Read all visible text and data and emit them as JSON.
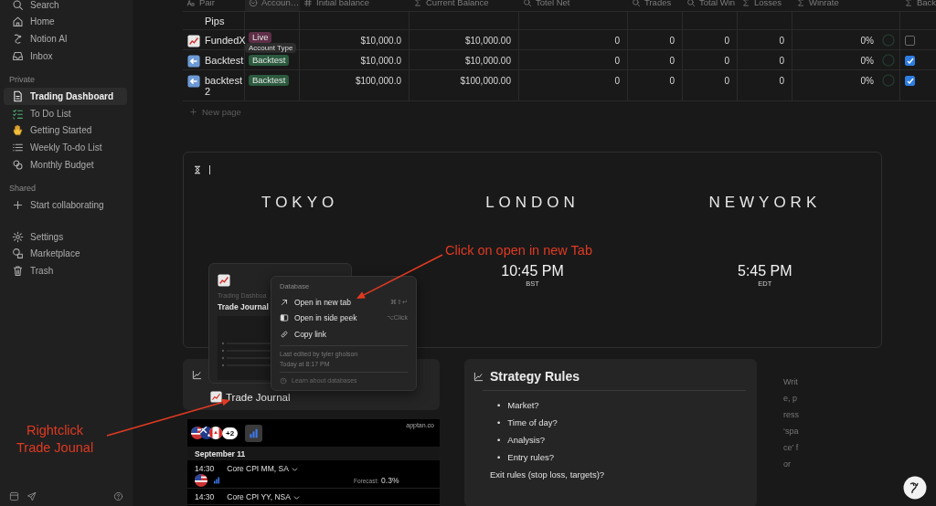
{
  "sidebar": {
    "groups": [
      {
        "items": [
          {
            "label": "Search",
            "selected": false
          },
          {
            "label": "Home",
            "selected": false
          },
          {
            "label": "Notion AI",
            "selected": false
          },
          {
            "label": "Inbox",
            "selected": false
          }
        ]
      },
      {
        "label": "Private",
        "items": [
          {
            "label": "Trading Dashboard",
            "selected": true
          },
          {
            "label": "To Do List",
            "selected": false
          },
          {
            "label": "Getting Started",
            "selected": false
          },
          {
            "label": "Weekly To-do List",
            "selected": false
          },
          {
            "label": "Monthly Budget",
            "selected": false
          }
        ]
      },
      {
        "label": "Shared",
        "items": [
          {
            "label": "Start collaborating",
            "selected": false
          }
        ]
      },
      {
        "items": [
          {
            "label": "Settings",
            "selected": false
          },
          {
            "label": "Marketplace",
            "selected": false
          },
          {
            "label": "Trash",
            "selected": false
          }
        ]
      }
    ]
  },
  "table": {
    "columns": [
      "Pair",
      "Accoun…",
      "Initial balance",
      "Current Balance",
      "Totel Net",
      "Trades",
      "Total Win",
      "Losses",
      "Winrate",
      "Back"
    ],
    "partial_row": {
      "pair": "Pips"
    },
    "rows": [
      {
        "pair": "FundedX",
        "account": {
          "label": "Live",
          "color": "#5e2f47"
        },
        "initial_balance": "$10,000.0",
        "current_balance": "$10,000.00",
        "total_net": "0",
        "trades": "0",
        "total_win": "0",
        "losses": "0",
        "winrate": "0%",
        "backtest": {
          "checked": false
        }
      },
      {
        "pair": "Backtest",
        "account": {
          "label": "Backtest",
          "color": "#2b5a3e"
        },
        "initial_balance": "$10,000.0",
        "current_balance": "$10,000.00",
        "total_net": "0",
        "trades": "0",
        "total_win": "0",
        "losses": "0",
        "winrate": "0%",
        "backtest": {
          "checked": true
        }
      },
      {
        "pair": "backtest 2",
        "account": {
          "label": "Backtest",
          "color": "#2b5a3e"
        },
        "initial_balance": "$100,000.0",
        "current_balance": "$100,000.00",
        "total_net": "0",
        "trades": "0",
        "total_win": "0",
        "losses": "0",
        "winrate": "0%",
        "backtest": {
          "checked": true
        }
      }
    ],
    "new_page": "New page",
    "tooltip": "Account Type"
  },
  "clock_widget": {
    "clocks": [
      {
        "city": "TOKYO"
      },
      {
        "city": "LONDON",
        "time": "10:45 PM",
        "zone": "BST"
      },
      {
        "city": "NEWYORK",
        "time": "5:45 PM",
        "zone": "EDT"
      }
    ]
  },
  "trade_journal": {
    "title": "Trade Journal"
  },
  "preview_card": {
    "breadcrumb": "Trading Dashboa",
    "title": "Trade Journal"
  },
  "context_menu": {
    "header": "Database",
    "items": [
      {
        "label": "Open in new tab",
        "shortcut": "⌘⇧↵"
      },
      {
        "label": "Open in side peek",
        "shortcut": "⌥Click"
      },
      {
        "label": "Copy link"
      }
    ],
    "edited_by": "Last edited by tyler gholson",
    "edited_at": "Today at 8:17 PM",
    "help": "Learn about databases"
  },
  "calendar_widget": {
    "more_count": "+2",
    "source": "apptan.co",
    "date": "September 11",
    "events": [
      {
        "time": "14:30",
        "title": "Core CPI MM, SA",
        "forecast_label": "Forecast:",
        "forecast": "0.3%"
      },
      {
        "time": "14:30",
        "title": "Core CPI YY, NSA"
      }
    ]
  },
  "strategy_rules": {
    "title": "Strategy Rules",
    "bullets": [
      {
        "marker": "•",
        "text": "Market?"
      },
      {
        "marker": "•",
        "text": "Time of day?"
      },
      {
        "marker": "•",
        "text": "Analysis?"
      },
      {
        "marker": "•",
        "text": "Entry rules?"
      }
    ],
    "note": "Exit rules (stop loss, targets)?"
  },
  "side_text": "Write, press ‘space’ for",
  "annotations": [
    {
      "text": "Click on open in new Tab"
    },
    {
      "text": "Rightclick\nTrade Jounal"
    }
  ]
}
